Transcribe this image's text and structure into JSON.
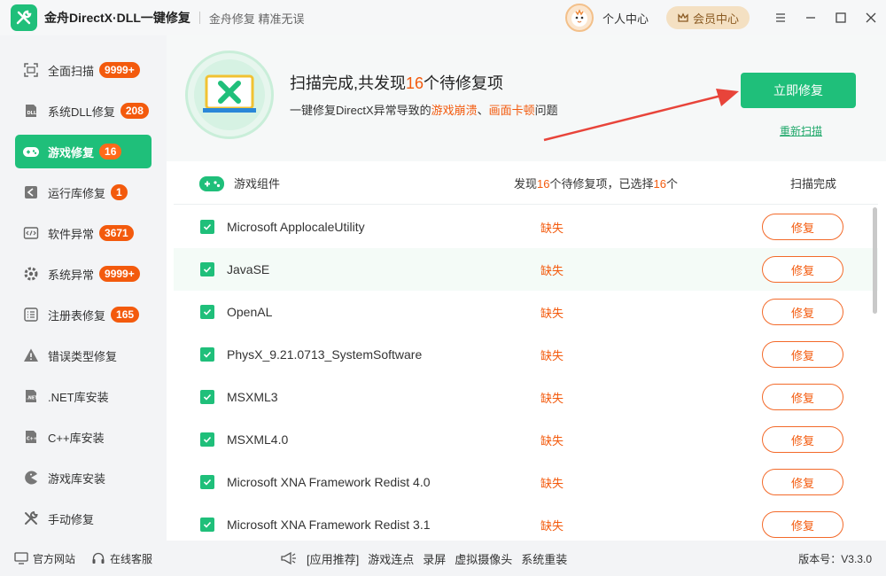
{
  "app": {
    "title": "金舟DirectX·DLL一键修复",
    "slogan": "金舟修复 精准无误",
    "personal_center": "个人中心",
    "vip_center": "会员中心"
  },
  "sidebar": {
    "items": [
      {
        "label": "全面扫描",
        "badge": "9999+",
        "icon": "scan-icon"
      },
      {
        "label": "系统DLL修复",
        "badge": "208",
        "icon": "dll-icon"
      },
      {
        "label": "游戏修复",
        "badge": "16",
        "icon": "gamepad-icon",
        "active": true
      },
      {
        "label": "运行库修复",
        "badge": "1",
        "icon": "runtime-icon"
      },
      {
        "label": "软件异常",
        "badge": "3671",
        "icon": "code-icon"
      },
      {
        "label": "系统异常",
        "badge": "9999+",
        "icon": "gear-icon"
      },
      {
        "label": "注册表修复",
        "badge": "165",
        "icon": "registry-icon"
      },
      {
        "label": "错误类型修复",
        "badge": "",
        "icon": "warning-icon"
      },
      {
        "label": ".NET库安装",
        "badge": "",
        "icon": "net-icon"
      },
      {
        "label": "C++库安装",
        "badge": "",
        "icon": "cpp-icon"
      },
      {
        "label": "游戏库安装",
        "badge": "",
        "icon": "pacman-icon"
      },
      {
        "label": "手动修复",
        "badge": "",
        "icon": "wrench-icon"
      }
    ]
  },
  "hero": {
    "title_pre": "扫描完成,共发现",
    "title_num": "16",
    "title_post": "个待修复项",
    "sub_pre": "一键修复DirectX异常导致的",
    "sub_hl1": "游戏崩溃",
    "sub_mid": "、",
    "sub_hl2": "画面卡顿",
    "sub_post": "问题",
    "fix_now": "立即修复",
    "rescan": "重新扫描"
  },
  "list": {
    "header_label": "游戏组件",
    "found_pre": "发现",
    "found_num": "16",
    "found_mid": "个待修复项，已选择",
    "selected_num": "16",
    "found_post": "个",
    "status_header": "扫描完成",
    "rows": [
      {
        "name": "Microsoft ApplocaleUtility",
        "status": "缺失",
        "action": "修复"
      },
      {
        "name": "JavaSE",
        "status": "缺失",
        "action": "修复"
      },
      {
        "name": "OpenAL",
        "status": "缺失",
        "action": "修复"
      },
      {
        "name": "PhysX_9.21.0713_SystemSoftware",
        "status": "缺失",
        "action": "修复"
      },
      {
        "name": "MSXML3",
        "status": "缺失",
        "action": "修复"
      },
      {
        "name": "MSXML4.0",
        "status": "缺失",
        "action": "修复"
      },
      {
        "name": "Microsoft XNA Framework Redist 4.0",
        "status": "缺失",
        "action": "修复"
      },
      {
        "name": "Microsoft XNA Framework Redist 3.1",
        "status": "缺失",
        "action": "修复"
      }
    ]
  },
  "footer": {
    "official_site": "官方网站",
    "online_service": "在线客服",
    "app_recommend": "[应用推荐]",
    "links": [
      "游戏连点",
      "录屏",
      "虚拟摄像头",
      "系统重装"
    ],
    "version": "版本号：V3.3.0"
  },
  "colors": {
    "accent": "#1fbf7a",
    "warning": "#f35a0d"
  }
}
